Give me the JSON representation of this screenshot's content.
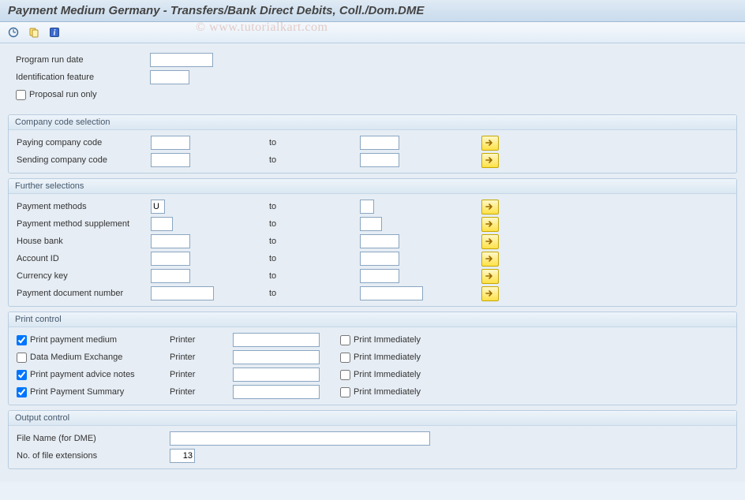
{
  "title": "Payment Medium Germany - Transfers/Bank Direct Debits, Coll./Dom.DME",
  "watermark": "© www.tutorialkart.com",
  "top": {
    "program_run_date_label": "Program run date",
    "program_run_date_value": "",
    "id_feature_label": "Identification feature",
    "id_feature_value": "",
    "proposal_label": "Proposal run only",
    "proposal_checked": false
  },
  "grp_company": {
    "title": "Company code selection",
    "rows": [
      {
        "label": "Paying company code",
        "from": "",
        "to_lbl": "to",
        "to": ""
      },
      {
        "label": "Sending company code",
        "from": "",
        "to_lbl": "to",
        "to": ""
      }
    ]
  },
  "grp_further": {
    "title": "Further selections",
    "rows": [
      {
        "label": "Payment methods",
        "from": "U",
        "to_lbl": "to",
        "to": "",
        "size": "s"
      },
      {
        "label": "Payment method supplement",
        "from": "",
        "to_lbl": "to",
        "to": "",
        "size": "s2"
      },
      {
        "label": "House bank",
        "from": "",
        "to_lbl": "to",
        "to": "",
        "size": "m"
      },
      {
        "label": "Account ID",
        "from": "",
        "to_lbl": "to",
        "to": "",
        "size": "m"
      },
      {
        "label": "Currency key",
        "from": "",
        "to_lbl": "to",
        "to": "",
        "size": "m"
      },
      {
        "label": "Payment document number",
        "from": "",
        "to_lbl": "to",
        "to": "",
        "size": "l"
      }
    ]
  },
  "grp_print": {
    "title": "Print control",
    "printer_label": "Printer",
    "immediate_label": "Print Immediately",
    "rows": [
      {
        "label": "Print payment medium",
        "checked": true,
        "printer": "",
        "immediate": false
      },
      {
        "label": "Data Medium Exchange",
        "checked": false,
        "printer": "",
        "immediate": false
      },
      {
        "label": "Print payment advice notes",
        "checked": true,
        "printer": "",
        "immediate": false
      },
      {
        "label": "Print Payment Summary",
        "checked": true,
        "printer": "",
        "immediate": false
      }
    ]
  },
  "grp_output": {
    "title": "Output control",
    "file_name_label": "File Name (for DME)",
    "file_name_value": "",
    "ext_label": "No. of file extensions",
    "ext_value": "13"
  }
}
